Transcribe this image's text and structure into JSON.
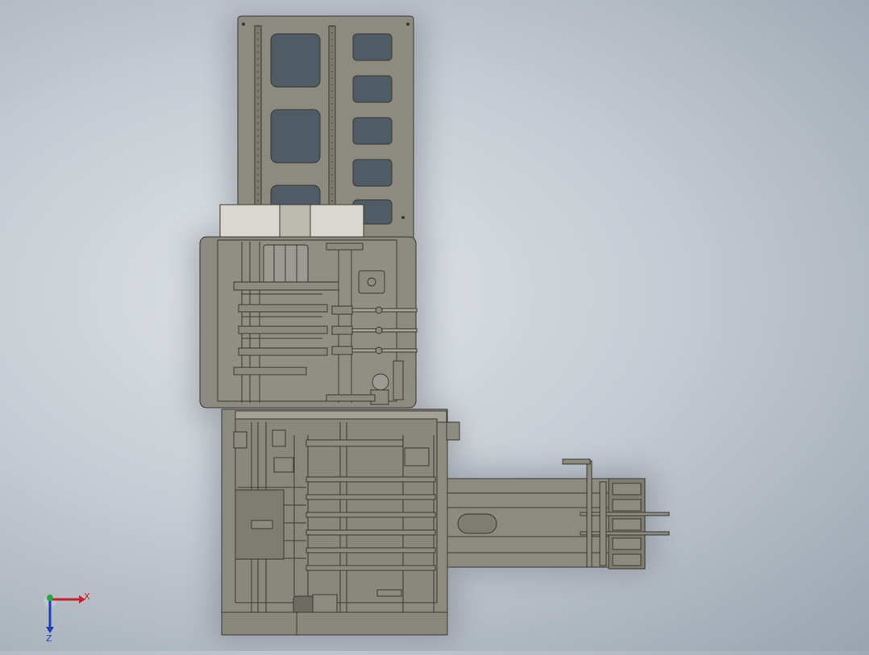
{
  "viewport": {
    "background_top": "#dfe3e8",
    "background_edge": "#9aa3ae",
    "model_color": "#8d8a7f",
    "model_shadow": "#7e7b71",
    "line_color": "#3a3832"
  },
  "triad": {
    "x_label": "X",
    "z_label": "Z",
    "x_color": "#c8202a",
    "y_color": "#1faa3a",
    "z_color": "#1e3fb8"
  }
}
